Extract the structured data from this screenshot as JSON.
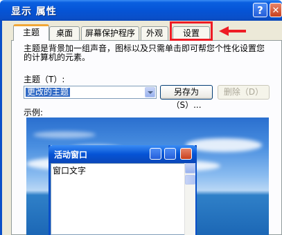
{
  "window": {
    "title": "显示 属性",
    "help_glyph": "?",
    "close_glyph": "✕"
  },
  "tabs": [
    {
      "label": "主题",
      "active": true
    },
    {
      "label": "桌面",
      "active": false
    },
    {
      "label": "屏幕保护程序",
      "active": false
    },
    {
      "label": "外观",
      "active": false
    },
    {
      "label": "设置",
      "active": false,
      "highlighted": true
    }
  ],
  "theme_page": {
    "description": "主题是背景加一组声音，图标以及只需单击即可帮您个性化设置您的计算机的元素。",
    "theme_label": "主题（T）:",
    "theme_select_value": "更改的主题",
    "save_as_button": "另存为（S）...",
    "delete_button": "删除（D）",
    "delete_enabled": false,
    "sample_label": "示例:"
  },
  "sample_window": {
    "title": "活动窗口",
    "body_text": "窗口文字"
  },
  "colors": {
    "xp_blue": "#0554d6",
    "annotation_red": "#ee1c25",
    "selection": "#316ac5"
  }
}
